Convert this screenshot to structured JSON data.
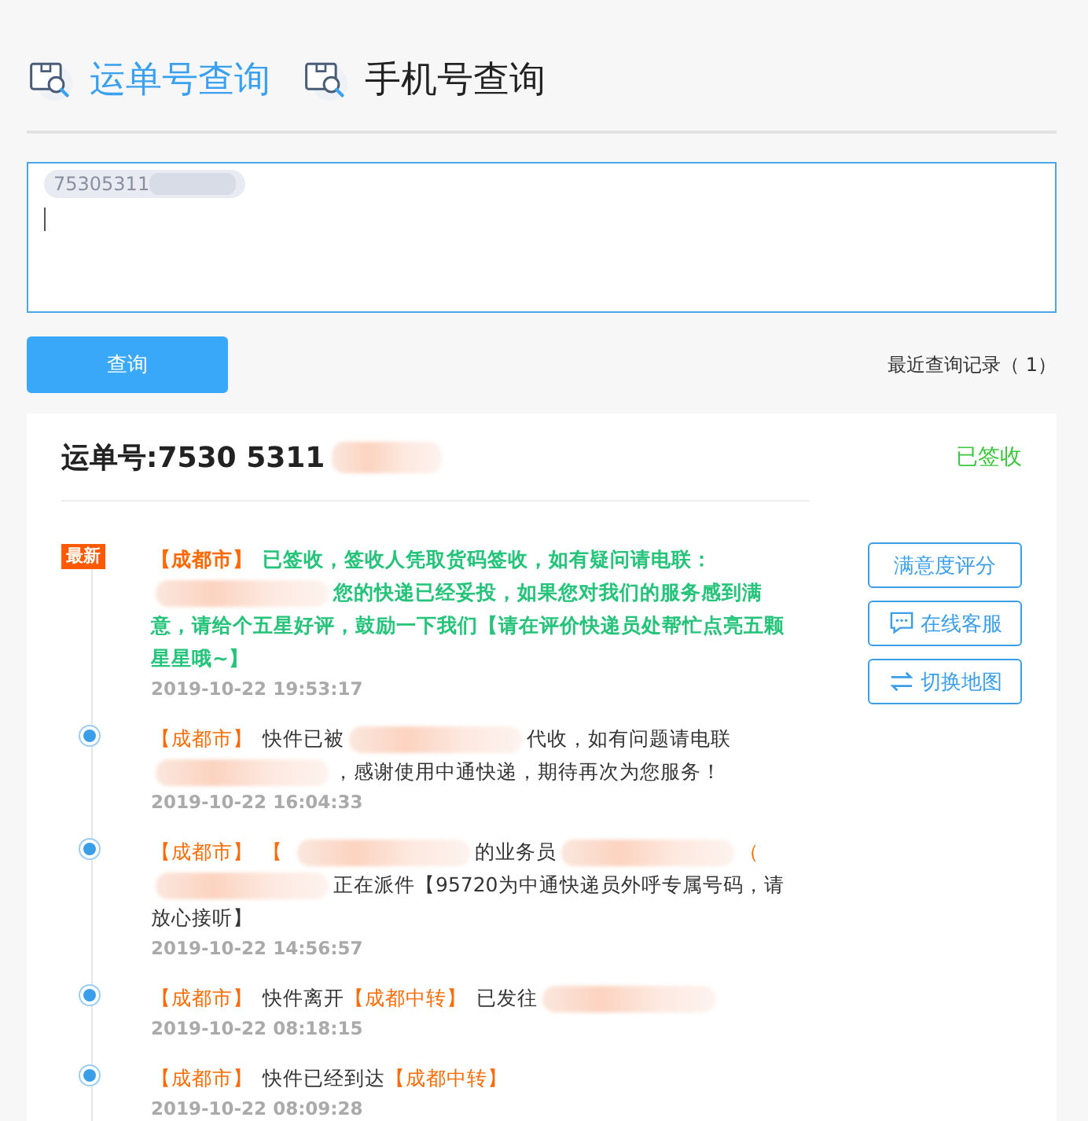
{
  "tabs": [
    {
      "label": "运单号查询",
      "selected": true
    },
    {
      "label": "手机号查询",
      "selected": false
    }
  ],
  "query_field": {
    "chip": "75305311"
  },
  "query_button": "查询",
  "history_link": "最近查询记录（ 1）",
  "result": {
    "title": "运单号:7530 5311",
    "status": "已签收",
    "actions": [
      {
        "label": "满意度评分",
        "kind": "plain"
      },
      {
        "label": "在线客服",
        "kind": "chat"
      },
      {
        "label": "切换地图",
        "kind": "swap"
      }
    ],
    "events": [
      {
        "latest": true,
        "badge": "最新",
        "time": "2019-10-22 19:53:17",
        "parts": [
          {
            "kind": "place",
            "text": "【成都市】"
          },
          {
            "kind": "text",
            "text": "已签收，签收人凭取货码签收，如有疑问请电联："
          },
          {
            "kind": "blur"
          },
          {
            "kind": "text",
            "text": "您的快递已经妥投，如果您对我们的服务感到满意，请给个五星好评，鼓励一下我们【请在评价快递员处帮忙点亮五颗星星哦~】"
          }
        ]
      },
      {
        "latest": false,
        "time": "2019-10-22 16:04:33",
        "parts": [
          {
            "kind": "place",
            "text": "【成都市】"
          },
          {
            "kind": "text",
            "text": "快件已被"
          },
          {
            "kind": "blur"
          },
          {
            "kind": "text",
            "text": "代收，如有问题请电联"
          },
          {
            "kind": "blur"
          },
          {
            "kind": "text",
            "text": "，感谢使用中通快递，期待再次为您服务！"
          }
        ]
      },
      {
        "latest": false,
        "time": "2019-10-22 14:56:57",
        "parts": [
          {
            "kind": "place",
            "text": "【成都市】"
          },
          {
            "kind": "place",
            "text": "【"
          },
          {
            "kind": "blur"
          },
          {
            "kind": "text",
            "text": "的业务员"
          },
          {
            "kind": "blur"
          },
          {
            "kind": "place",
            "text": "（"
          },
          {
            "kind": "blur"
          },
          {
            "kind": "text",
            "text": "正在派件【95720为中通快递员外呼专属号码，请放心接听】"
          }
        ]
      },
      {
        "latest": false,
        "time": "2019-10-22 08:18:15",
        "parts": [
          {
            "kind": "place",
            "text": "【成都市】"
          },
          {
            "kind": "text",
            "text": "快件离开"
          },
          {
            "kind": "place",
            "text": "【成都中转】"
          },
          {
            "kind": "text",
            "text": "已发往"
          },
          {
            "kind": "blur"
          }
        ]
      },
      {
        "latest": false,
        "time": "2019-10-22 08:09:28",
        "parts": [
          {
            "kind": "place",
            "text": "【成都市】"
          },
          {
            "kind": "text",
            "text": "快件已经到达"
          },
          {
            "kind": "place",
            "text": "【成都中转】"
          }
        ]
      }
    ]
  }
}
